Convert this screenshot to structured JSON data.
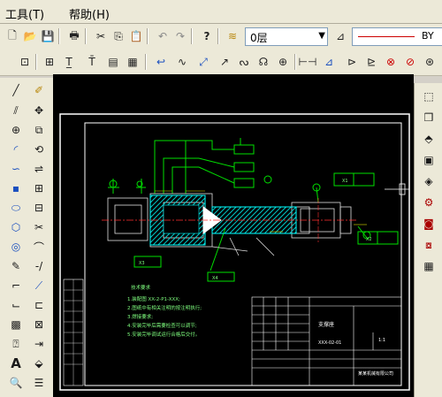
{
  "menu": {
    "tools": "工具(T)",
    "help": "帮助(H)"
  },
  "toolbar1": {
    "layer_value": "0层",
    "bylayer": "BY",
    "buttons": [
      "new-doc-icon",
      "open-folder-icon",
      "save-icon",
      "print-icon",
      "cut-icon",
      "copy-icon",
      "paste-icon",
      "undo-icon",
      "redo-icon",
      "help-icon",
      "layers-icon",
      "layer-prop-icon"
    ]
  },
  "toolbar2": {
    "buttons": [
      "zoom-extents-icon",
      "zoom-window-icon",
      "zoom-text-icon",
      "text-edit-icon",
      "render-icon",
      "curve-icon",
      "wave-icon",
      "arrow-diag-icon",
      "arrow-icon",
      "spline-icon",
      "lasso-icon",
      "center-icon",
      "dimension-icon",
      "angle-dim-icon",
      "surface-icon",
      "node-icon",
      "node-move-icon",
      "node-delete-icon"
    ]
  },
  "left_tools": {
    "col1": [
      "line-icon",
      "double-line-icon",
      "circle-icon",
      "arc-icon",
      "spline-icon",
      "rectangle-icon",
      "ellipse-icon",
      "polygon-icon",
      "point-icon",
      "pencil-icon",
      "corner-icon",
      "hatch-icon",
      "region-icon",
      "text-icon",
      "zoom-icon"
    ],
    "col2": [
      "eraser-icon",
      "move-icon",
      "copy-obj-icon",
      "rotate-icon",
      "mirror-icon",
      "array-icon",
      "offset-icon",
      "trim-icon",
      "fillet-icon",
      "break-icon",
      "chamfer-icon",
      "stretch-icon",
      "scale-icon",
      "insert-icon",
      "explode-icon",
      "layer-icon"
    ]
  },
  "right_tools": [
    "cube-icon",
    "cube-front-icon",
    "cube-side-icon",
    "box-icon",
    "shape-icon",
    "gear-icon",
    "flange-icon",
    "fixture-icon",
    "panel-icon"
  ],
  "drawing": {
    "notes_title": "技术要求",
    "notes": [
      "1.装配图 XX-2-P1-XXX;",
      "2.图纸中有相关注明的按注明执行;",
      "3.焊接要求;",
      "4.安装完毕后需要检查可以调节;",
      "5.安装完毕调试运行合格后交付。"
    ],
    "part_label_1": "主体",
    "part_label_2": "Ф1.5",
    "callouts": [
      "X1",
      "X2",
      "X3",
      "X4"
    ],
    "title_block": {
      "name": "支撑座",
      "code": "XXX-02-01",
      "company": "某某机械有限公司",
      "scale": "1:1"
    }
  }
}
